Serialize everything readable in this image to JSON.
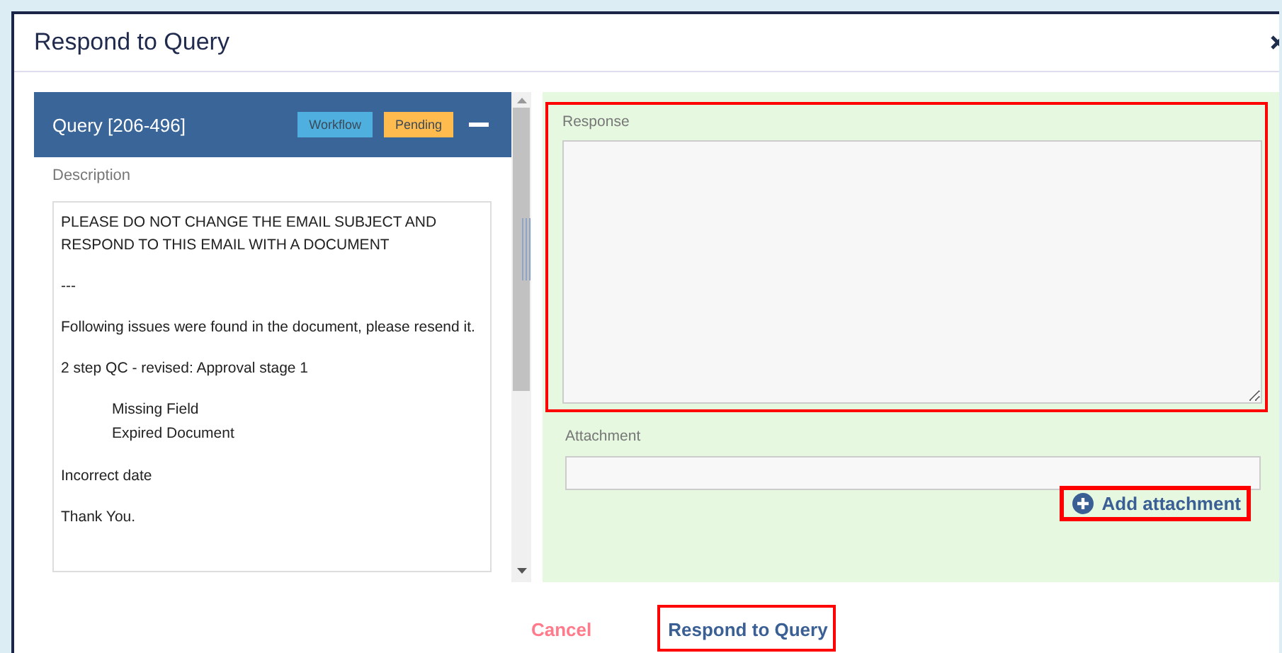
{
  "dialog": {
    "title": "Respond to Query"
  },
  "query": {
    "title": "Query [206-496]",
    "badges": [
      {
        "label": "Workflow",
        "color": "#4fb0e0"
      },
      {
        "label": "Pending",
        "color": "#ffbb4d"
      }
    ],
    "expanded": true,
    "description_label": "Description",
    "description": [
      {
        "kind": "para",
        "text": "PLEASE DO NOT CHANGE THE EMAIL SUBJECT AND RESPOND TO THIS EMAIL WITH A DOCUMENT"
      },
      {
        "kind": "para",
        "text": "---"
      },
      {
        "kind": "para",
        "text": "Following issues were found in the document, please resend it."
      },
      {
        "kind": "para",
        "text": "2 step QC - revised: Approval stage 1"
      },
      {
        "kind": "list",
        "lines": [
          "Missing Field",
          "Expired Document"
        ]
      },
      {
        "kind": "para",
        "text": "Incorrect date"
      },
      {
        "kind": "para",
        "text": "Thank You."
      }
    ]
  },
  "response": {
    "label": "Response",
    "highlighted": true
  },
  "attachment": {
    "label": "Attachment",
    "add_label": "Add attachment",
    "add_highlighted": true
  },
  "buttons": [
    {
      "kind": "cancel",
      "label": "Cancel",
      "highlighted": false
    },
    {
      "kind": "primary",
      "label": "Respond to Query",
      "highlighted": true
    }
  ]
}
